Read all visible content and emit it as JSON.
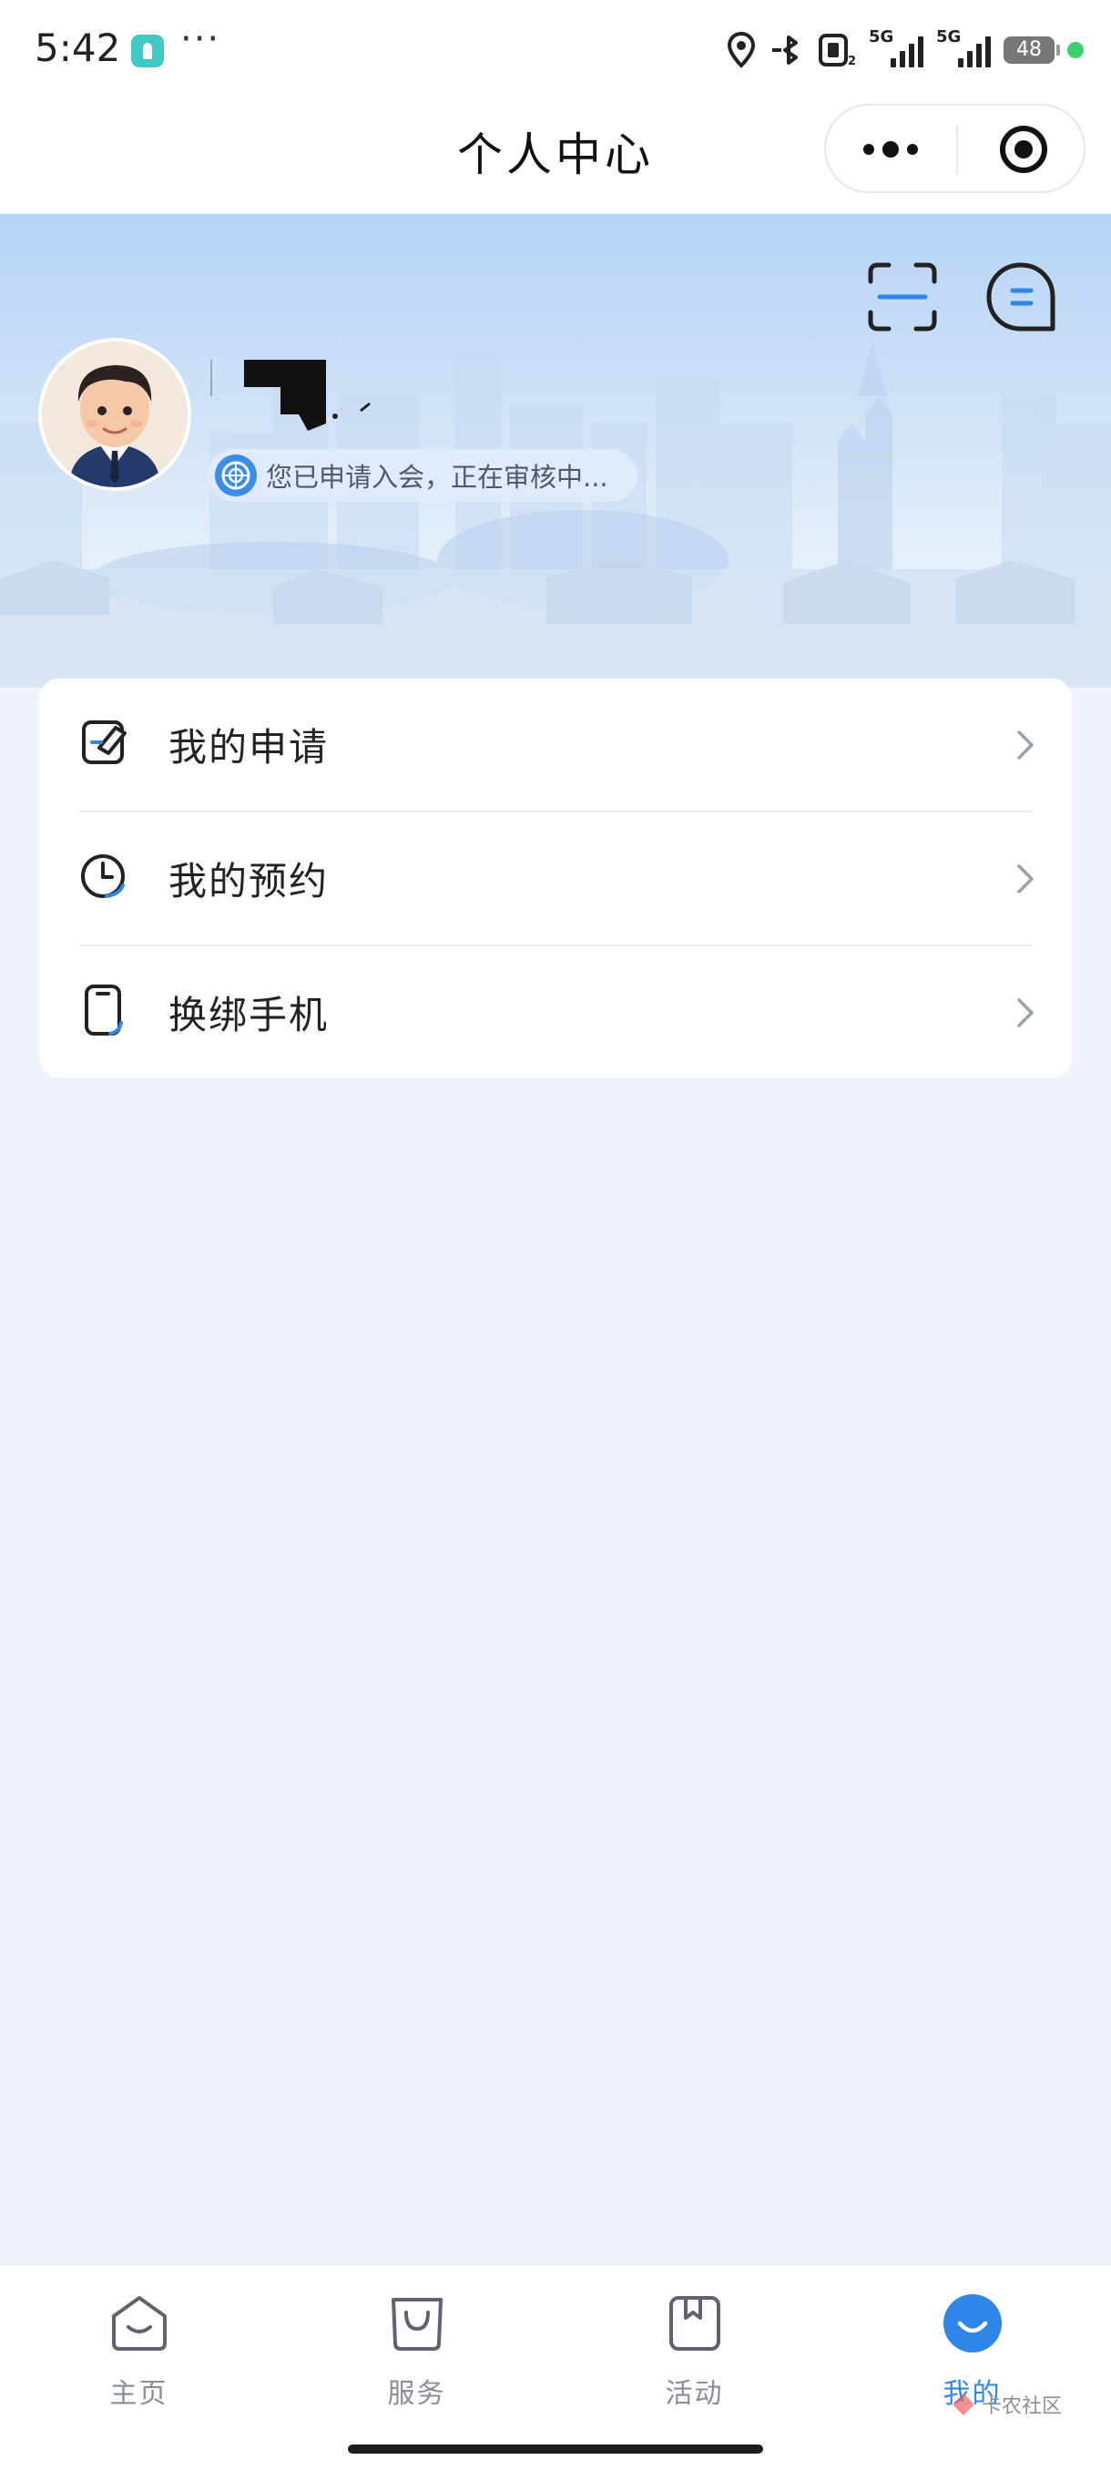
{
  "status_bar": {
    "time": "5:42",
    "more": "···",
    "signal1": "5G",
    "signal2": "5G",
    "battery": "48"
  },
  "title_bar": {
    "title": "个人中心"
  },
  "profile": {
    "status_text": "您已申请入会，正在审核中..."
  },
  "menu": {
    "items": [
      {
        "label": "我的申请",
        "icon": "application-edit-icon"
      },
      {
        "label": "我的预约",
        "icon": "clock-icon"
      },
      {
        "label": "换绑手机",
        "icon": "phone-icon"
      }
    ]
  },
  "bottom_nav": {
    "items": [
      {
        "label": "主页",
        "icon": "home-icon",
        "active": false
      },
      {
        "label": "服务",
        "icon": "shopping-bag-icon",
        "active": false
      },
      {
        "label": "活动",
        "icon": "bookmark-icon",
        "active": false
      },
      {
        "label": "我的",
        "icon": "profile-icon",
        "active": true
      }
    ]
  },
  "watermark": {
    "text": "卡农社区"
  },
  "colors": {
    "accent": "#2f86e8",
    "header_top": "#b6d4f6",
    "page_bg": "#f0f4fa",
    "inactive_nav": "#8a8f97"
  }
}
